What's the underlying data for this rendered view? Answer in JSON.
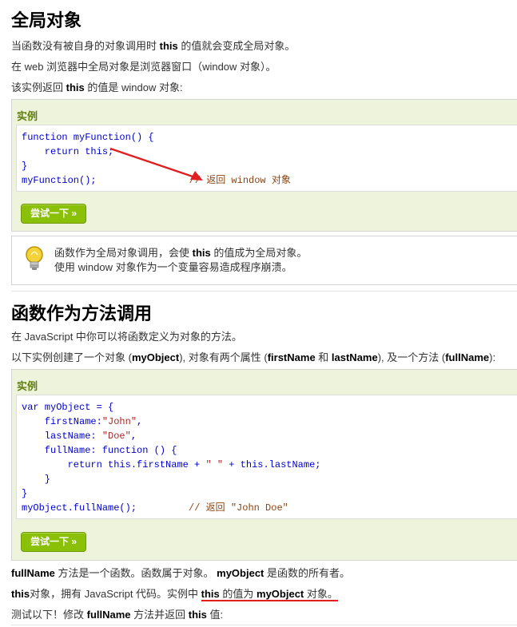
{
  "section1": {
    "title": "全局对象",
    "p1_pre": "当函数没有被自身的对象调用时 ",
    "p1_bold": "this",
    "p1_post": " 的值就会变成全局对象。",
    "p2": "在 web 浏览器中全局对象是浏览器窗口（window 对象）。",
    "p3_pre": "该实例返回 ",
    "p3_bold": "this",
    "p3_post": " 的值是 window 对象:"
  },
  "example1": {
    "title": "实例",
    "code": {
      "l1_kw": "function",
      "l1_rest": " myFunction() {",
      "l2_kw": "    return",
      "l2_rest": " this;",
      "l3": "}",
      "l4_code": "myFunction();",
      "l4_comment": "// 返回 window 对象"
    },
    "button": "尝试一下 »"
  },
  "tip": {
    "line1_pre": "函数作为全局对象调用，会使 ",
    "line1_bold": "this",
    "line1_post": " 的值成为全局对象。",
    "line2": "使用 window 对象作为一个变量容易造成程序崩溃。"
  },
  "section2": {
    "title": "函数作为方法调用",
    "p1": "在 JavaScript 中你可以将函数定义为对象的方法。",
    "p2_a": "以下实例创建了一个对象 (",
    "p2_b": "myObject",
    "p2_c": "), 对象有两个属性 (",
    "p2_d": "firstName",
    "p2_e": " 和 ",
    "p2_f": "lastName",
    "p2_g": "), 及一个方法 (",
    "p2_h": "fullName",
    "p2_i": "):"
  },
  "example2": {
    "title": "实例",
    "code": {
      "l1_kw": "var",
      "l1_rest": " myObject = {",
      "l2_key": "    firstName:",
      "l2_str": "\"John\"",
      "l2_end": ",",
      "l3_key": "    lastName: ",
      "l3_str": "\"Doe\"",
      "l3_end": ",",
      "l4_key": "    fullName: ",
      "l4_kw": "function",
      "l4_rest": " () {",
      "l5_kw": "        return",
      "l5_a": " this.firstName + ",
      "l5_str": "\" \"",
      "l5_b": " + this.lastName;",
      "l6": "    }",
      "l7": "}",
      "l8_code": "myObject.fullName();",
      "l8_comment": "// 返回 \"John Doe\""
    },
    "button": "尝试一下 »"
  },
  "footer": {
    "p1_a": "fullName",
    "p1_b": " 方法是一个函数。函数属于对象。 ",
    "p1_c": "myObject",
    "p1_d": " 是函数的所有者。",
    "p2_a": "this",
    "p2_b": "对象，拥有 JavaScript 代码。实例中 ",
    "p2_c": "this",
    "p2_d": " 的值为 ",
    "p2_e": "myObject",
    "p2_f": " 对象。",
    "p3_a": "测试以下！修改 ",
    "p3_b": "fullName",
    "p3_c": " 方法并返回 ",
    "p3_d": "this",
    "p3_e": " 值:"
  },
  "colors": {
    "accent_green": "#8ac007",
    "example_bg": "#eef3dc",
    "annotation_red": "#e02020"
  },
  "icons": {
    "tip": "lightbulb-icon",
    "annotation": "red-arrow-annotation"
  }
}
